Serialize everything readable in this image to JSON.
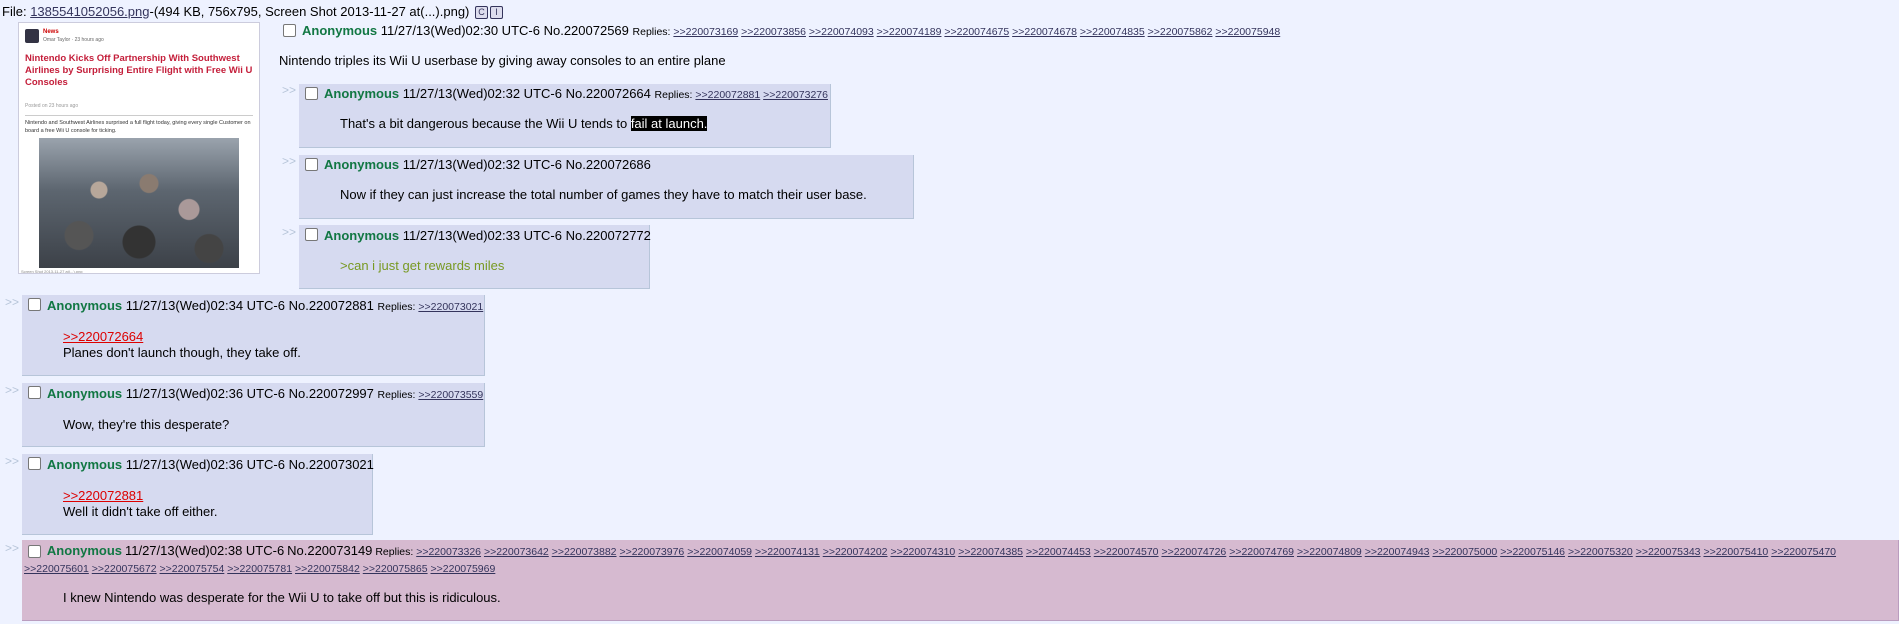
{
  "file": {
    "label": "File:",
    "name": "1385541052056.png",
    "info": "-(494 KB, 756x795, Screen Shot 2013-11-27 at(...).png)",
    "btn1": "C",
    "btn2": "I"
  },
  "thumbnail": {
    "section": "News",
    "author": "Omar Taylor · 23 hours ago",
    "title": "Nintendo Kicks Off Partnership With Southwest Airlines by Surprising Entire Flight with Free Wii U Consoles",
    "meta": "Posted on 23 hours ago",
    "body": "Nintendo and Southwest Airlines surprised a full flight today, giving every single Customer on board a free Wii U console for ticking.",
    "caption": "Screen Shot 2013-11-27 at(...).png"
  },
  "arrows": ">>",
  "op": {
    "name": "Anonymous",
    "datetime": "11/27/13(Wed)02:30 UTC-6",
    "no": "No.220072569",
    "replies_label": "Replies:",
    "replies": [
      ">>220073169",
      ">>220073856",
      ">>220074093",
      ">>220074189",
      ">>220074675",
      ">>220074678",
      ">>220074835",
      ">>220075862",
      ">>220075948"
    ],
    "message": "Nintendo triples its Wii U userbase by giving away consoles to an entire plane"
  },
  "posts": [
    {
      "name": "Anonymous",
      "datetime": "11/27/13(Wed)02:32 UTC-6",
      "no": "No.220072664",
      "replies_label": "Replies:",
      "replies": [
        ">>220072881",
        ">>220073276"
      ],
      "message_pre": "That's a bit dangerous because the Wii U tends to ",
      "message_sel": "fail at launch."
    },
    {
      "name": "Anonymous",
      "datetime": "11/27/13(Wed)02:32 UTC-6",
      "no": "No.220072686",
      "message": "Now if they can just increase the total number of games they have to match their user base."
    },
    {
      "name": "Anonymous",
      "datetime": "11/27/13(Wed)02:33 UTC-6",
      "no": "No.220072772",
      "greentext": ">can i just get rewards miles"
    },
    {
      "name": "Anonymous",
      "datetime": "11/27/13(Wed)02:34 UTC-6",
      "no": "No.220072881",
      "replies_label": "Replies:",
      "replies": [
        ">>220073021"
      ],
      "quote": ">>220072664",
      "message": "Planes don't launch though, they take off."
    },
    {
      "name": "Anonymous",
      "datetime": "11/27/13(Wed)02:36 UTC-6",
      "no": "No.220072997",
      "replies_label": "Replies:",
      "replies": [
        ">>220073559"
      ],
      "message": "Wow, they're this desperate?"
    },
    {
      "name": "Anonymous",
      "datetime": "11/27/13(Wed)02:36 UTC-6",
      "no": "No.220073021",
      "quote": ">>220072881",
      "message": "Well it didn't take off either."
    },
    {
      "name": "Anonymous",
      "datetime": "11/27/13(Wed)02:38 UTC-6",
      "no": "No.220073149",
      "replies_label": "Replies:",
      "replies": [
        ">>220073326",
        ">>220073642",
        ">>220073882",
        ">>220073976",
        ">>220074059",
        ">>220074131",
        ">>220074202",
        ">>220074310",
        ">>220074385",
        ">>220074453",
        ">>220074570",
        ">>220074726",
        ">>220074769",
        ">>220074809",
        ">>220074943",
        ">>220075000",
        ">>220075146",
        ">>220075320",
        ">>220075343",
        ">>220075410",
        ">>220075470",
        ">>220075601",
        ">>220075672",
        ">>220075754",
        ">>220075781",
        ">>220075842",
        ">>220075865",
        ">>220075969"
      ],
      "message": "I knew Nintendo was desperate for the Wii U to take off but this is ridiculous."
    }
  ]
}
